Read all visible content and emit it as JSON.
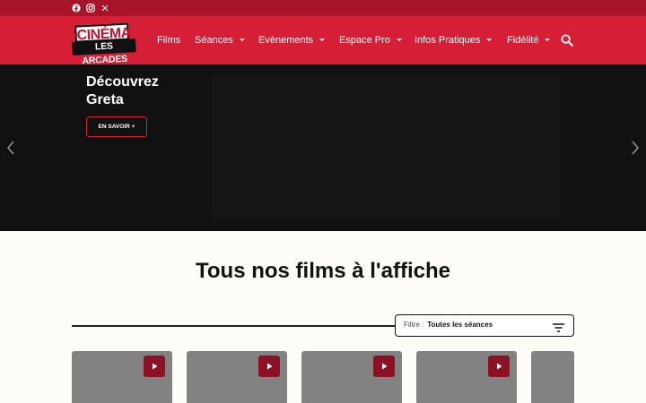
{
  "social": {
    "icons": [
      "facebook-icon",
      "instagram-icon",
      "x-icon"
    ]
  },
  "logo": {
    "line1": "CINÉMA",
    "line2": "LES ARCADES"
  },
  "nav": {
    "items": [
      {
        "label": "Films",
        "has_dropdown": false
      },
      {
        "label": "Séances",
        "has_dropdown": true
      },
      {
        "label": "Evènements",
        "has_dropdown": true
      },
      {
        "label": "Espace Pro",
        "has_dropdown": true
      },
      {
        "label": "Infos Pratiques",
        "has_dropdown": true
      },
      {
        "label": "Fidélité",
        "has_dropdown": true
      }
    ],
    "search_icon": "search-icon"
  },
  "hero": {
    "title": "Découvrez Greta",
    "button_label": "EN SAVOIR +"
  },
  "films": {
    "title": "Tous nos films à l'affiche",
    "filter_label": "Filtre :",
    "filter_value": "Toutes les séances",
    "poster_count_visible": 5
  },
  "colors": {
    "topbar": "#a8142a",
    "navbar": "#d61f36",
    "hero_bg": "#111111",
    "page_bg": "#fdfcf6",
    "play_button": "#8e1024",
    "poster_placeholder": "#828282"
  }
}
